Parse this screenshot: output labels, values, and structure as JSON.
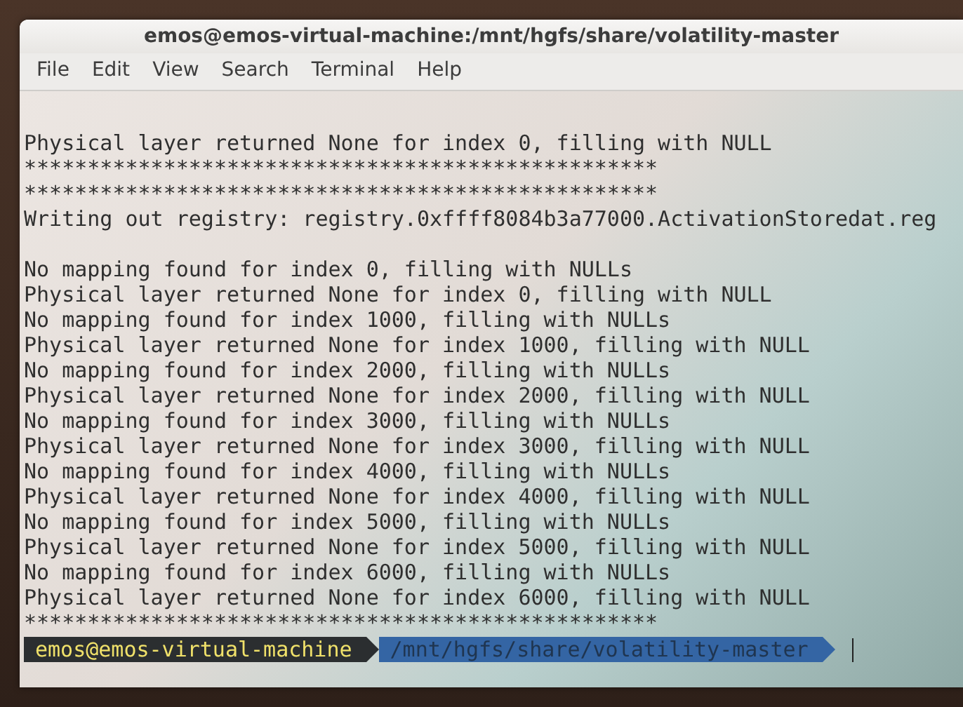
{
  "window": {
    "title": "emos@emos-virtual-machine:/mnt/hgfs/share/volatility-master"
  },
  "menu": [
    "File",
    "Edit",
    "View",
    "Search",
    "Terminal",
    "Help"
  ],
  "terminal": {
    "lines": [
      {
        "kind": "blank"
      },
      {
        "kind": "text",
        "text": "Physical layer returned None for index 0, filling with NULL"
      },
      {
        "kind": "text",
        "text": "**************************************************"
      },
      {
        "kind": "text",
        "text": "**************************************************"
      },
      {
        "kind": "text",
        "text": "Writing out registry: registry.0xffff8084b3a77000.ActivationStoredat.reg"
      },
      {
        "kind": "blank"
      },
      {
        "kind": "text",
        "text": "No mapping found for index 0, filling with NULLs"
      },
      {
        "kind": "text",
        "text": "Physical layer returned None for index 0, filling with NULL"
      },
      {
        "kind": "text",
        "text": "No mapping found for index 1000, filling with NULLs"
      },
      {
        "kind": "text",
        "text": "Physical layer returned None for index 1000, filling with NULL"
      },
      {
        "kind": "text",
        "text": "No mapping found for index 2000, filling with NULLs"
      },
      {
        "kind": "text",
        "text": "Physical layer returned None for index 2000, filling with NULL"
      },
      {
        "kind": "text",
        "text": "No mapping found for index 3000, filling with NULLs"
      },
      {
        "kind": "text",
        "text": "Physical layer returned None for index 3000, filling with NULL"
      },
      {
        "kind": "text",
        "text": "No mapping found for index 4000, filling with NULLs"
      },
      {
        "kind": "text",
        "text": "Physical layer returned None for index 4000, filling with NULL"
      },
      {
        "kind": "text",
        "text": "No mapping found for index 5000, filling with NULLs"
      },
      {
        "kind": "text",
        "text": "Physical layer returned None for index 5000, filling with NULL"
      },
      {
        "kind": "text",
        "text": "No mapping found for index 6000, filling with NULLs"
      },
      {
        "kind": "text",
        "text": "Physical layer returned None for index 6000, filling with NULL"
      },
      {
        "kind": "text",
        "text": "**************************************************"
      }
    ],
    "prompt": {
      "user_host": "emos@emos-virtual-machine",
      "path": "/mnt/hgfs/share/volatility-master"
    }
  }
}
